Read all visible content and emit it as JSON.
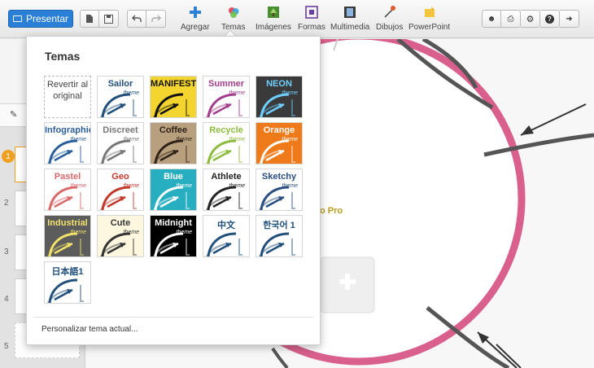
{
  "toolbar": {
    "present_label": "Presentar",
    "tools": [
      {
        "label": "Agregar",
        "icon": "plus-icon"
      },
      {
        "label": "Temas",
        "icon": "palette-icon"
      },
      {
        "label": "Imágenes",
        "icon": "image-icon"
      },
      {
        "label": "Formas",
        "icon": "shapes-icon"
      },
      {
        "label": "Multimedia",
        "icon": "film-icon"
      },
      {
        "label": "Dibujos",
        "icon": "draw-icon"
      },
      {
        "label": "PowerPoint",
        "icon": "powerpoint-icon"
      }
    ],
    "right_icons": [
      "users-icon",
      "print-icon",
      "gear-icon",
      "help-icon",
      "exit-icon"
    ]
  },
  "slides": [
    {
      "number": "1"
    },
    {
      "number": "2"
    },
    {
      "number": "3"
    },
    {
      "number": "4"
    },
    {
      "number": "5"
    }
  ],
  "themes_panel": {
    "title": "Temas",
    "revert_label": "Revertir al original",
    "themes": [
      {
        "name": "Sailor",
        "sub": "theme",
        "bg": "#ffffff",
        "fg": "#1f4f7a"
      },
      {
        "name": "MANIFESTO",
        "sub": "",
        "bg": "#f4d42e",
        "fg": "#111111"
      },
      {
        "name": "Summer",
        "sub": "theme",
        "bg": "#ffffff",
        "fg": "#a03d8c"
      },
      {
        "name": "NEON",
        "sub": "theme",
        "bg": "#3a3a3a",
        "fg": "#6fd0ff"
      },
      {
        "name": "Infographic",
        "sub": "theme",
        "bg": "#ffffff",
        "fg": "#2a5e9b"
      },
      {
        "name": "Discreet",
        "sub": "theme",
        "bg": "#ffffff",
        "fg": "#777777"
      },
      {
        "name": "Coffee",
        "sub": "theme",
        "bg": "#b8a07e",
        "fg": "#2f2318"
      },
      {
        "name": "Recycle",
        "sub": "theme",
        "bg": "#ffffff",
        "fg": "#8dbb3c"
      },
      {
        "name": "Orange",
        "sub": "theme",
        "bg": "#ee7a1a",
        "fg": "#ffffff"
      },
      {
        "name": "Pastel",
        "sub": "theme",
        "bg": "#ffffff",
        "fg": "#d86a6a"
      },
      {
        "name": "Geo",
        "sub": "theme",
        "bg": "#ffffff",
        "fg": "#c0392b"
      },
      {
        "name": "Blue",
        "sub": "theme",
        "bg": "#27aec0",
        "fg": "#ffffff"
      },
      {
        "name": "Athlete",
        "sub": "theme",
        "bg": "#ffffff",
        "fg": "#222222"
      },
      {
        "name": "Sketchy",
        "sub": "theme",
        "bg": "#ffffff",
        "fg": "#2b4f80"
      },
      {
        "name": "Industrial",
        "sub": "theme",
        "bg": "#5c5c5c",
        "fg": "#f2e26a"
      },
      {
        "name": "Cute",
        "sub": "theme",
        "bg": "#fdf7e0",
        "fg": "#333333"
      },
      {
        "name": "Midnight",
        "sub": "theme",
        "bg": "#000000",
        "fg": "#ffffff"
      },
      {
        "name": "中文",
        "sub": "",
        "bg": "#ffffff",
        "fg": "#1f4f7a"
      },
      {
        "name": "한국어 1",
        "sub": "",
        "bg": "#ffffff",
        "fg": "#1f4f7a"
      },
      {
        "name": "日本語1",
        "sub": "",
        "bg": "#ffffff",
        "fg": "#1f4f7a"
      }
    ],
    "customize_label": "Personalizar tema actual..."
  },
  "canvas": {
    "partial_text": "o Pro"
  },
  "colors": {
    "accent": "#2a7fd6",
    "ring": "#d9608c"
  }
}
